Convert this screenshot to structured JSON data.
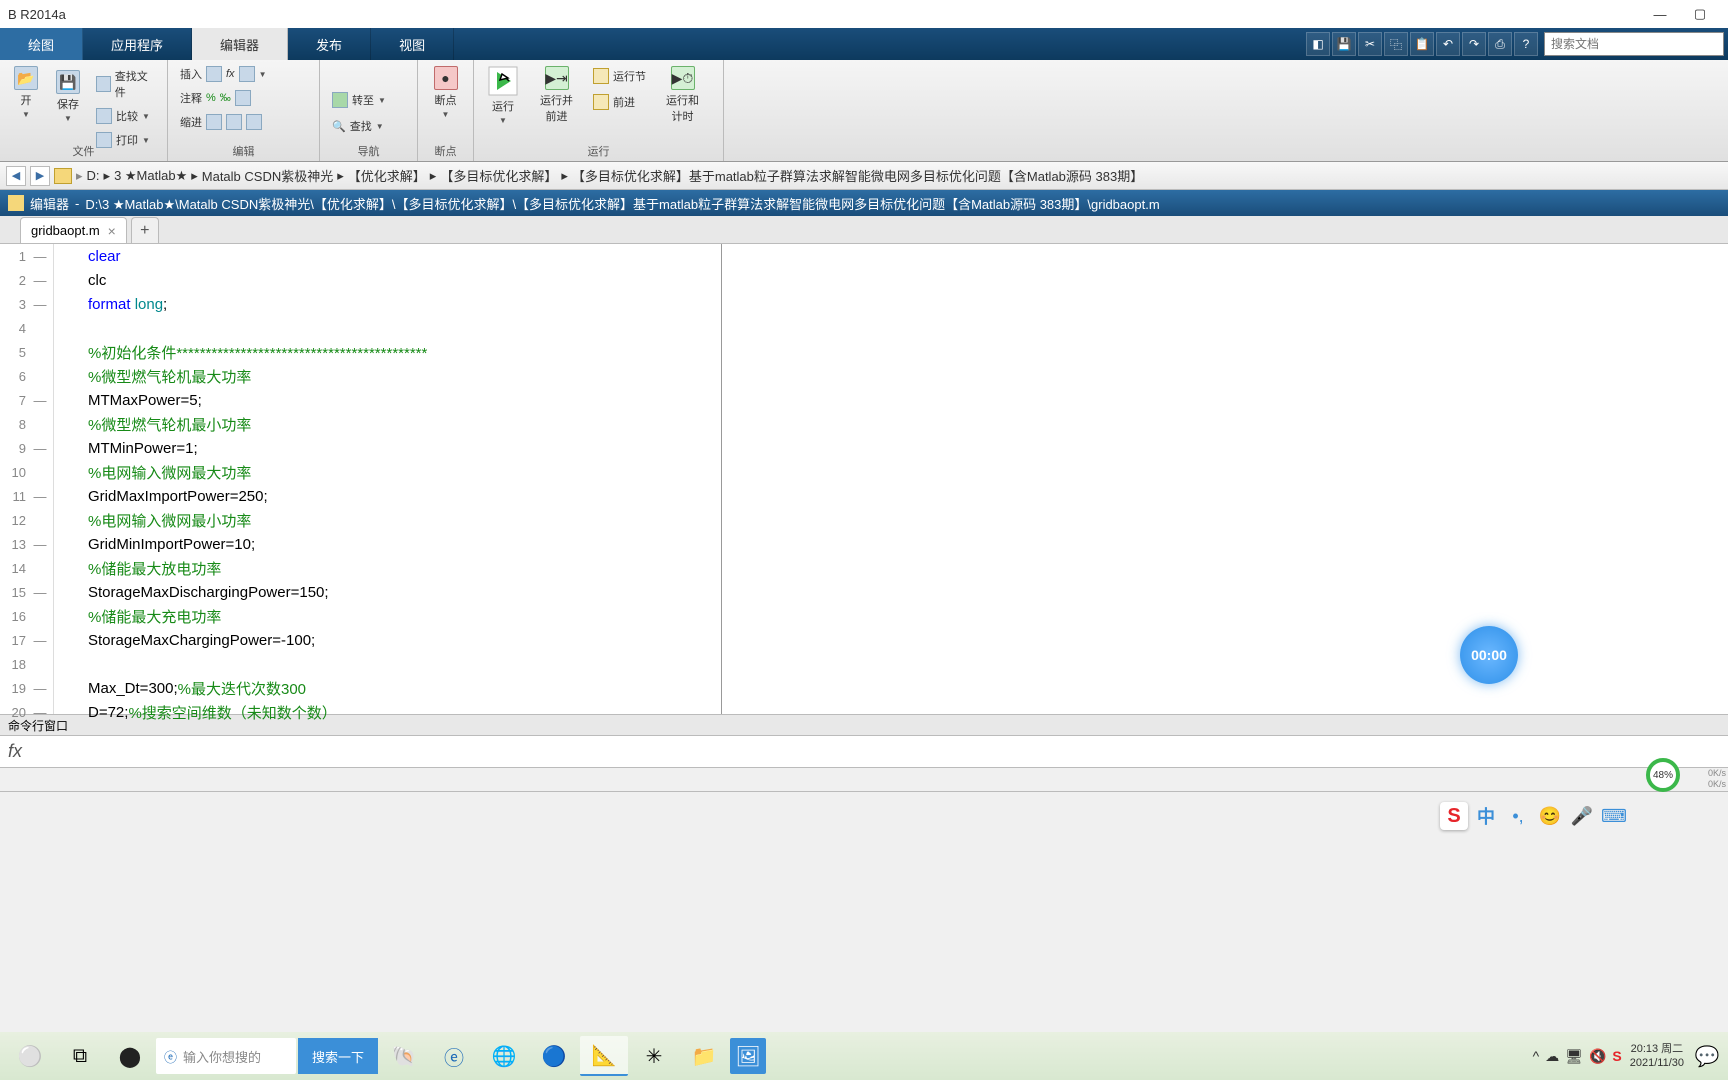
{
  "window": {
    "title": "B R2014a"
  },
  "ribbon": {
    "tabs": [
      "绘图",
      "应用程序",
      "编辑器",
      "发布",
      "视图"
    ],
    "search_placeholder": "搜索文档"
  },
  "toolstrip": {
    "file_group": "文件",
    "open": "开",
    "save": "保存",
    "find_files": "查找文件",
    "compare": "比较",
    "print": "打印",
    "edit_group": "编辑",
    "insert": "插入",
    "comment": "注释",
    "indent": "缩进",
    "fx": "fx",
    "nav_group": "导航",
    "goto": "转至",
    "find": "查找",
    "bp_group": "断点",
    "breakpoint": "断点",
    "run_group": "运行",
    "run": "运行",
    "run_advance": "运行并\n前进",
    "run_section": "运行节",
    "advance": "前进",
    "run_time": "运行和\n计时"
  },
  "breadcrumb": {
    "items": [
      "D:",
      "3 ★Matlab★",
      "Matalb CSDN紫极神光",
      "【优化求解】",
      "【多目标优化求解】",
      "【多目标优化求解】基于matlab粒子群算法求解智能微电网多目标优化问题【含Matlab源码 383期】"
    ]
  },
  "editor_bar": {
    "label": "编辑器",
    "path": "D:\\3 ★Matlab★\\Matalb CSDN紫极神光\\【优化求解】\\【多目标优化求解】\\【多目标优化求解】基于matlab粒子群算法求解智能微电网多目标优化问题【含Matlab源码 383期】\\gridbaopt.m"
  },
  "file_tab": {
    "name": "gridbaopt.m"
  },
  "code": {
    "lines": [
      {
        "n": 1,
        "dash": "—",
        "segs": [
          {
            "t": "clear",
            "c": "blue"
          }
        ]
      },
      {
        "n": 2,
        "dash": "—",
        "segs": [
          {
            "t": "clc",
            "c": "black"
          }
        ]
      },
      {
        "n": 3,
        "dash": "—",
        "segs": [
          {
            "t": "format ",
            "c": "blue"
          },
          {
            "t": "long",
            "c": "teal"
          },
          {
            "t": ";",
            "c": "black"
          }
        ]
      },
      {
        "n": 4,
        "dash": "",
        "segs": []
      },
      {
        "n": 5,
        "dash": "",
        "segs": [
          {
            "t": "%初始化条件*******************************************",
            "c": "green"
          }
        ]
      },
      {
        "n": 6,
        "dash": "",
        "segs": [
          {
            "t": "%微型燃气轮机最大功率",
            "c": "green"
          }
        ]
      },
      {
        "n": 7,
        "dash": "—",
        "segs": [
          {
            "t": "MTMaxPower=5;",
            "c": "black"
          }
        ]
      },
      {
        "n": 8,
        "dash": "",
        "segs": [
          {
            "t": "%微型燃气轮机最小功率",
            "c": "green"
          }
        ]
      },
      {
        "n": 9,
        "dash": "—",
        "segs": [
          {
            "t": "MTMinPower=1;",
            "c": "black"
          }
        ]
      },
      {
        "n": 10,
        "dash": "",
        "segs": [
          {
            "t": "%电网输入微网最大功率",
            "c": "green"
          }
        ]
      },
      {
        "n": 11,
        "dash": "—",
        "segs": [
          {
            "t": "GridMaxImportPower=250;",
            "c": "black"
          }
        ]
      },
      {
        "n": 12,
        "dash": "",
        "segs": [
          {
            "t": "%电网输入微网最小功率",
            "c": "green"
          }
        ]
      },
      {
        "n": 13,
        "dash": "—",
        "segs": [
          {
            "t": "GridMinImportPower=10;",
            "c": "black"
          }
        ]
      },
      {
        "n": 14,
        "dash": "",
        "segs": [
          {
            "t": "%储能最大放电功率",
            "c": "green"
          }
        ]
      },
      {
        "n": 15,
        "dash": "—",
        "segs": [
          {
            "t": "StorageMaxDischargingPower=150;",
            "c": "black"
          }
        ]
      },
      {
        "n": 16,
        "dash": "",
        "segs": [
          {
            "t": "%储能最大充电功率",
            "c": "green"
          }
        ]
      },
      {
        "n": 17,
        "dash": "—",
        "segs": [
          {
            "t": "StorageMaxChargingPower=-100;",
            "c": "black"
          }
        ]
      },
      {
        "n": 18,
        "dash": "",
        "segs": []
      },
      {
        "n": 19,
        "dash": "—",
        "segs": [
          {
            "t": "Max_Dt=300;",
            "c": "black"
          },
          {
            "t": "%最大迭代次数300",
            "c": "green"
          }
        ]
      },
      {
        "n": 20,
        "dash": "—",
        "segs": [
          {
            "t": "D=72;",
            "c": "black"
          },
          {
            "t": "%搜索空间维数（未知数个数）",
            "c": "green"
          }
        ]
      }
    ]
  },
  "timer": {
    "value": "00:00"
  },
  "cmd": {
    "title": "命令行窗口",
    "prompt": "fx"
  },
  "perf": {
    "pct": "48%",
    "up": "0K/s",
    "dn": "0K/s"
  },
  "ime": {
    "s": "S",
    "zh": "中"
  },
  "tb": {
    "search_ph": "输入你想搜的",
    "search_btn": "搜索一下",
    "time": "20:13 周二",
    "date": "2021/11/30"
  }
}
